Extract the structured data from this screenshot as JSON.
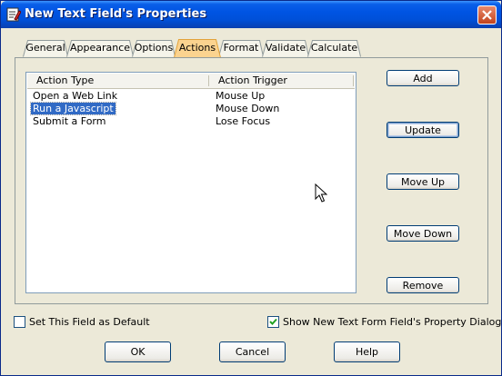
{
  "window": {
    "title": "New Text Field's Properties"
  },
  "tabs": [
    "General",
    "Appearance",
    "Options",
    "Actions",
    "Format",
    "Validate",
    "Calculate"
  ],
  "active_tab": "Actions",
  "actions_table": {
    "headers": [
      "Action Type",
      "Action Trigger"
    ],
    "rows": [
      {
        "type": "Open a Web Link",
        "trigger": "Mouse Up"
      },
      {
        "type": "Run a Javascript",
        "trigger": "Mouse Down",
        "selected": true
      },
      {
        "type": "Submit a Form",
        "trigger": "Lose Focus"
      }
    ]
  },
  "side_buttons": {
    "add": "Add",
    "update": "Update",
    "move_up": "Move Up",
    "move_down": "Move Down",
    "remove": "Remove"
  },
  "options": {
    "set_default_label": "Set This Field as Default",
    "set_default_checked": false,
    "show_dialog_label": "Show New Text Form Field's Property Dialog",
    "show_dialog_checked": true
  },
  "footer": {
    "ok": "OK",
    "cancel": "Cancel",
    "help": "Help"
  },
  "colors": {
    "selection": "#316ac5",
    "active_tab": "#fbd38f",
    "titlebar": "#0054e3"
  }
}
